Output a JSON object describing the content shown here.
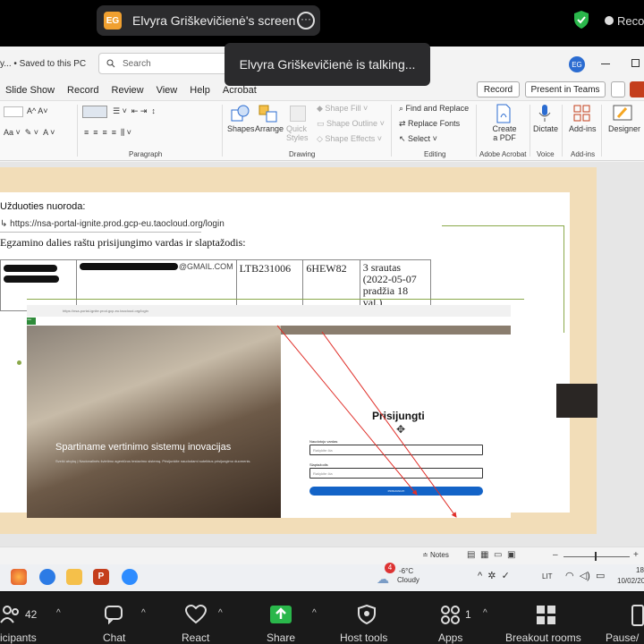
{
  "zoom_top": {
    "share_initials": "EG",
    "share_label": "Elvyra Griškevičienė's screen",
    "recording_label": "Reco",
    "talking_label": "Elvyra Griškevičienė is talking..."
  },
  "ppt": {
    "saved_label": "y... • Saved to this PC",
    "search_placeholder": "Search",
    "avatar_initials": "EG",
    "menu": [
      "Slide Show",
      "Record",
      "Review",
      "View",
      "Help",
      "Acrobat"
    ],
    "record_button": "Record",
    "present_teams_button": "Present in Teams",
    "ribbon": {
      "paragraph_label": "Paragraph",
      "drawing_label": "Drawing",
      "editing_label": "Editing",
      "acrobat_label": "Adobe Acrobat",
      "voice_label": "Voice",
      "addins_label": "Add-ins",
      "shapes": "Shapes",
      "arrange": "Arrange",
      "quick_styles": "Quick Styles",
      "shape_fill": "Shape Fill",
      "shape_outline": "Shape Outline",
      "shape_effects": "Shape Effects",
      "find_replace": "Find and Replace",
      "replace_fonts": "Replace Fonts",
      "select": "Select",
      "create_pdf": "Create a PDF",
      "dictate": "Dictate",
      "addins": "Add-ins",
      "designer": "Designer"
    },
    "slide": {
      "instruction_heading": "Užduoties nuoroda:",
      "url": "https://nsa-portal-ignite.prod.gcp-eu.taocloud.org/login",
      "credentials_heading": "Egzamino dalies raštu prisijungimo vardas ir slaptažodis:",
      "table_email_suffix": "@GMAIL.COM",
      "username": "LTB231006",
      "password": "6HEW82",
      "stream": "3 srautas (2022-05-07 pradžia 18 val.)",
      "screenshot": {
        "browser_url": "https://nsa-portal-ignite.prod.gcp-eu.taocloud.org/login",
        "logo": "nsa",
        "hero_heading": "Spartiname vertinimo sistemų inovacijas",
        "hero_sub": "Sveiki atvykę į Nacionalinės švietimo agentūros testavimo sistemą. Prisijunkite naudodami suteiktus prisijungimo duomenis.",
        "login_title": "Prisijungti",
        "username_label": "Naudotojo vardas",
        "username_placeholder": "Rašykite čia",
        "password_label": "Slaptažodis",
        "password_placeholder": "Rašykite čia",
        "login_button": "PRISIJUNGTI"
      }
    },
    "status": {
      "notes": "Notes"
    }
  },
  "taskbar": {
    "weather_badge": "4",
    "temperature": "-6°C",
    "weather": "Cloudy",
    "language": "LIT",
    "time": "18",
    "date": "10/02/20"
  },
  "zoom_bottom": {
    "participants_count": "42",
    "participants_label": "icipants",
    "chat_label": "Chat",
    "react_label": "React",
    "share_label": "Share",
    "host_tools_label": "Host tools",
    "apps_count": "1",
    "apps_label": "Apps",
    "breakout_label": "Breakout rooms",
    "pause_label": "Pause/"
  },
  "colors": {
    "share_green": "#2ab74b",
    "ppt_accent": "#c43e1c",
    "zoom_bar": "#1a1a1a",
    "login_button": "#1363c7"
  }
}
